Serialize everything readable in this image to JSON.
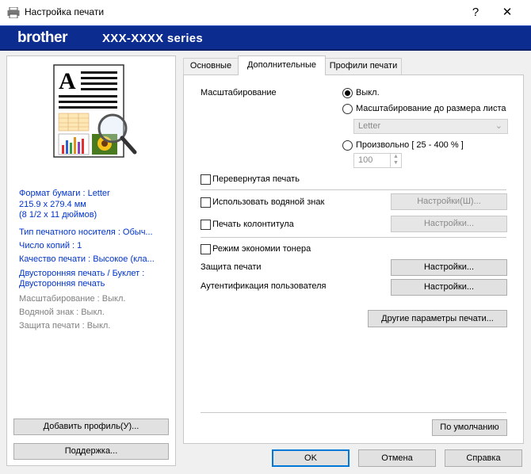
{
  "window": {
    "title": "Настройка печати",
    "help_glyph": "?",
    "close_glyph": "✕",
    "icon": "printer-icon"
  },
  "brand": {
    "logo": "brother",
    "model": "XXX-XXXX series",
    "color": "#0d2c8f"
  },
  "summary": {
    "paper_size_line1": "Формат бумаги : Letter",
    "paper_size_line2": "215.9 x 279.4 мм",
    "paper_size_line3": "(8 1/2 x 11 дюймов)",
    "media_type": "Тип печатного носителя : Обыч...",
    "copies": "Число копий : 1",
    "quality": "Качество печати : Высокое (кла...",
    "duplex_line1": "Двусторонняя печать / Буклет :",
    "duplex_line2": "Двусторонняя печать",
    "scaling": "Масштабирование : Выкл.",
    "watermark": "Водяной знак : Выкл.",
    "protection": "Защита печати : Выкл."
  },
  "left_buttons": {
    "add_profile": "Добавить профиль(У)...",
    "support": "Поддержка..."
  },
  "tabs": [
    {
      "label": "Основные",
      "active": false
    },
    {
      "label": "Дополнительные",
      "active": true
    },
    {
      "label": "Профили печати",
      "active": false
    }
  ],
  "scaling": {
    "label": "Масштабирование",
    "option_off": "Выкл.",
    "option_fit": "Масштабирование до размера листа",
    "fit_select_value": "Letter",
    "option_free": "Произвольно [ 25 - 400 % ]",
    "free_value": "100",
    "selected": "off"
  },
  "options": {
    "reverse_print": "Перевернутая печать",
    "watermark": "Использовать водяной знак",
    "watermark_settings": "Настройки(Ш)...",
    "header_footer": "Печать колонтитула",
    "header_footer_settings": "Настройки...",
    "toner_save": "Режим экономии тонера",
    "secure_print": "Защита печати",
    "secure_print_settings": "Настройки...",
    "user_auth": "Аутентификация пользователя",
    "user_auth_settings": "Настройки...",
    "other_options": "Другие параметры печати...",
    "defaults": "По умолчанию"
  },
  "footer": {
    "ok": "OK",
    "cancel": "Отмена",
    "help": "Справка"
  }
}
